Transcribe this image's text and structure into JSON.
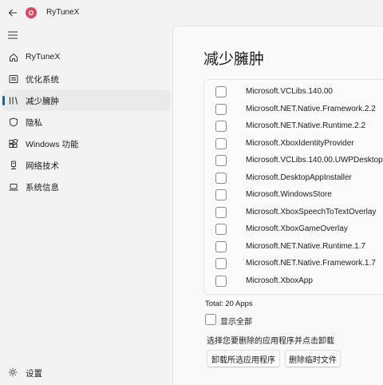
{
  "app": {
    "title": "RyTuneX"
  },
  "nav": {
    "items": [
      {
        "label": "RyTuneX",
        "icon": "home-icon",
        "selected": false
      },
      {
        "label": "优化系统",
        "icon": "optimize-icon",
        "selected": false
      },
      {
        "label": "减少臃肿",
        "icon": "debloat-icon",
        "selected": true
      },
      {
        "label": "隐私",
        "icon": "shield-icon",
        "selected": false
      },
      {
        "label": "Windows 功能",
        "icon": "apps-grid-icon",
        "selected": false
      },
      {
        "label": "网络技术",
        "icon": "network-icon",
        "selected": false
      },
      {
        "label": "系统信息",
        "icon": "laptop-icon",
        "selected": false
      }
    ],
    "settings_label": "设置"
  },
  "page": {
    "title": "减少臃肿",
    "apps": [
      "Microsoft.VCLibs.140.00",
      "Microsoft.NET.Native.Framework.2.2",
      "Microsoft.NET.Native.Runtime.2.2",
      "Microsoft.XboxIdentityProvider",
      "Microsoft.VCLibs.140.00.UWPDesktop",
      "Microsoft.DesktopAppInstaller",
      "Microsoft.WindowsStore",
      "Microsoft.XboxSpeechToTextOverlay",
      "Microsoft.XboxGameOverlay",
      "Microsoft.NET.Native.Runtime.1.7",
      "Microsoft.NET.Native.Framework.1.7",
      "Microsoft.XboxApp"
    ],
    "total": "Total: 20 Apps",
    "show_all": "显示全部",
    "hint": "选择您要删除的应用程序并点击卸载",
    "uninstall_button": "卸载所选应用程序",
    "delete_temp_button": "删除临时文件"
  },
  "colors": {
    "accent": "#0067c0"
  }
}
